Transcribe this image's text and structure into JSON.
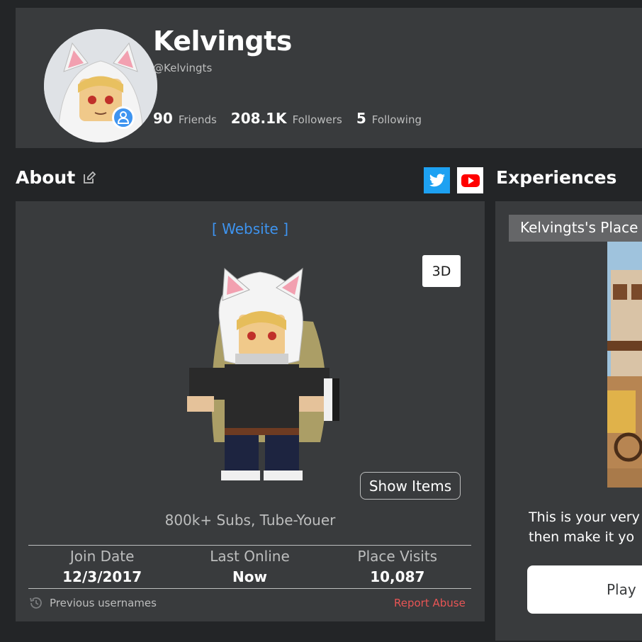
{
  "profile": {
    "display_name": "Kelvingts",
    "username": "@Kelvingts",
    "stats": [
      {
        "value": "90",
        "label": "Friends"
      },
      {
        "value": "208.1K",
        "label": "Followers"
      },
      {
        "value": "5",
        "label": "Following"
      }
    ]
  },
  "about": {
    "title": "About",
    "website_link": "[ Website ]",
    "btn_3d": "3D",
    "show_items": "Show Items",
    "blurb": "800k+ Subs, Tube-Youer",
    "stats": [
      {
        "label": "Join Date",
        "value": "12/3/2017"
      },
      {
        "label": "Last Online",
        "value": "Now"
      },
      {
        "label": "Place Visits",
        "value": "10,087"
      }
    ],
    "previous_usernames": "Previous usernames",
    "report_abuse": "Report Abuse"
  },
  "experiences": {
    "title": "Experiences",
    "place_name": "Kelvingts's Place",
    "description": "This is your very\nthen make it yo",
    "play_label": "Play"
  },
  "colors": {
    "background": "#232527",
    "card": "#393b3d",
    "accent_blue": "#3e94f0",
    "report_red": "#e85555",
    "twitter": "#1da1f2",
    "youtube": "#ff0000"
  }
}
